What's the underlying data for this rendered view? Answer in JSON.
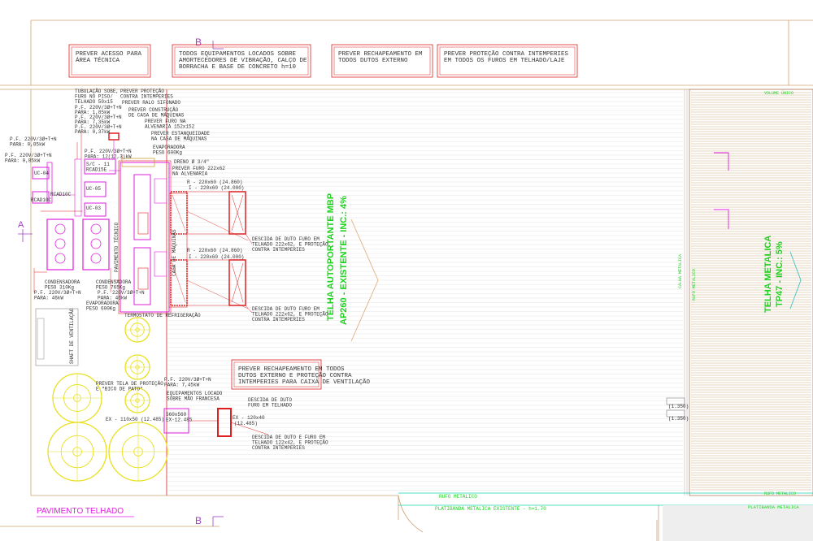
{
  "drawing": {
    "section_mark": "B",
    "section_mark_side": "A",
    "title": "PAVIMENTO TELHADO",
    "roof_main": {
      "line1": "TELHA AUTOPORTANTE MBP",
      "line2": "AP260 - EXISTENTE - INC.: 4%"
    },
    "roof_right": {
      "line1": "TELHA METALICA",
      "line2": "TP47 - INC.: 5%"
    },
    "calha": "CALHA METALICA",
    "rufo_vertical": "RUFO METALICO",
    "rufo_bottom": "RUFO METALICO",
    "platibanda": "PLATIBANDA METALICA EXISTENTE - h=1.70",
    "platibanda_right": "PLATIBANDA METALICA",
    "rufo_right_bottom": "RUFO METALICO",
    "top_right_label": "VOLUME ÚNICO",
    "notes": [
      {
        "lines": [
          "PREVER ACESSO PARA",
          "ÁREA TÉCNICA"
        ]
      },
      {
        "lines": [
          "TODOS EQUIPAMENTOS LOCADOS SOBRE",
          "AMORTECEDORES DE VIBRAÇÃO, CALÇO DE",
          "BORRACHA E BASE DE CONCRETO h=10"
        ]
      },
      {
        "lines": [
          "PREVER RECHAPEAMENTO EM",
          "TODOS DUTOS EXTERNO"
        ]
      },
      {
        "lines": [
          "PREVER PROTEÇÃO CONTRA INTEMPERIES",
          "EM TODOS OS FUROS EM TELHADO/LAJE"
        ]
      },
      {
        "lines": [
          "PREVER RECHAPEAMENTO EM TODOS",
          "DUTOS EXTERNO E PROTEÇÃO CONTRA",
          "INTEMPERIES PARA CAIXA DE VENTILAÇÃO"
        ]
      }
    ],
    "labels": {
      "tubulacao": [
        "TUBULAÇÃO SOBE,",
        "FURO NO PISO/",
        "TELHADO 50x15"
      ],
      "prever_protecao": [
        "PREVER PROTEÇÃO",
        "CONTRA INTEMPERIES"
      ],
      "prever_ralo": "PREVER RALO SIFONADO",
      "prever_construcao": [
        "PREVER CONSTRUÇÃO",
        "DE CASA DE MÁQUINAS"
      ],
      "prever_furo": [
        "PREVER FURO NA",
        "ALVENARIA 152x152"
      ],
      "prever_estanqueidade": [
        "PREVER ESTANQUEIDADE",
        "NA CASA DE MÁQUINAS"
      ],
      "evap1": [
        "EVAPORADORA",
        "PESO 600Kg"
      ],
      "dreno": "DRENO Ø 3/4\"",
      "prever_furo2": [
        "PREVER FURO 222x62",
        "NA ALVENARIA"
      ],
      "duct1a": "R - 220x60 (24.860)",
      "duct1b": "I - 220x60 (24.000)",
      "duct2a": "R - 220x60 (24.860)",
      "duct2b": "I - 220x60 (24.000)",
      "descida1": [
        "DESCIDA DE DUTO FURO EM",
        "TELHADO 222x62, E PROTEÇÃO",
        "CONTRA INTEMPERIES"
      ],
      "descida2": [
        "DESCIDA DE DUTO FURO EM",
        "TELHADO 222x62, E PROTEÇÃO",
        "CONTRA INTEMPERIES"
      ],
      "pf_left1": [
        "P.F. 220V/3Ø+T+N",
        "PARA: 0,85kW"
      ],
      "pf_left2": [
        "P.F. 220V/3Ø+T+N",
        "PARA: 0,85kW"
      ],
      "pf_top": [
        "P.F. 220V/3Ø+T+N",
        "PARA: 1,85kW",
        "P.F. 220V/3Ø+T+N",
        "PARA: 7,35kW",
        "P.F. 220V/3Ø+T+N",
        "PARA: 0,37kW"
      ],
      "pf_mid": [
        "P.F. 220V/3Ø+T+N",
        "PARA: 12(12,3)kW"
      ],
      "sc": [
        "S/C - 11",
        "RCAD15E"
      ],
      "uc1": "UC-04",
      "uc2": "UC-05",
      "uc3": "UC-03",
      "rc1": "RCAD10C",
      "rc2": "RCAD10C",
      "pavimento_tecnico": "PAVIMENTO TÉCNICO",
      "casa_maquinas": "CASA DE MÁQUINAS",
      "cond1": [
        "CONDENSADORA",
        "PESO 310Kg"
      ],
      "cond2": [
        "CONDENSADORA",
        "PESO 765Kg"
      ],
      "pf_cond1": [
        "P.F. 220V/3Ø+T+N",
        "PARA: 46kW"
      ],
      "pf_cond2": [
        "P.F. 220V/3Ø+T+N",
        "PARA: 46kW"
      ],
      "evap2": [
        "EVAPORADORA",
        "PESO 600Kg"
      ],
      "termostato": "TERMOSTATO DE REFRIGERAÇÃO",
      "prever_tela": [
        "PREVER TELA DE PROTEÇÃO",
        "E \"BICO DE PATO\""
      ],
      "equip_locado": [
        "EQUIPAMENTOS LOCADO",
        "SOBRE MÃO FRANCESA"
      ],
      "pf_bottom": [
        "P.F. 220V/3Ø+T+N",
        "PARA: 7,45kW"
      ],
      "ex1": "EX - 110x50 (12.485)",
      "ex2": "EX - 120x40",
      "ex2b": "(12.485)",
      "descida_duto": [
        "DESCIDA DE DUTO",
        "FURO EM TELHADO"
      ],
      "descida3": [
        "DESCIDA DE DUTO E FURO EM",
        "TELHADO 122x42, E PROTEÇÃO",
        "CONTRA INTEMPERIES"
      ],
      "vent_box": [
        "560x560",
        "EX-12.485"
      ],
      "elev_tags": [
        "(1.350)",
        "(1.350)"
      ],
      "left_panel": "SHAFT DE VENTILAÇÃO"
    }
  }
}
